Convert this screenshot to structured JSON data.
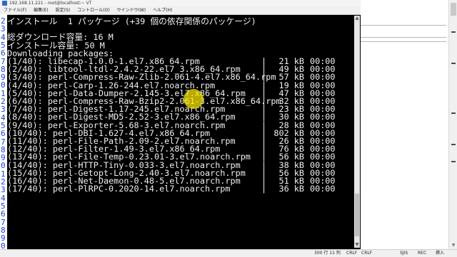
{
  "window": {
    "title": "192.168.11.221 - root@localhost:~ VT"
  },
  "menu": [
    "ファイル(F)",
    "編集(E)",
    "設定(S)",
    "コントロール(O)",
    "ウインドウ(W)",
    "ヘルプ(H)"
  ],
  "terminal": {
    "header_lines": [
      "インストール  1 パッケージ (+39 個の依存関係のパッケージ)",
      "",
      "総ダウンロード容量: 16 M",
      "インストール容量: 50 M",
      "Downloading packages:"
    ],
    "packages": [
      {
        "name": "(1/40): libecap-1.0.0-1.el7.x86_64.rpm",
        "size": "21 kB",
        "time": "00:00"
      },
      {
        "name": "(2/40): libtool-ltdl-2.4.2-22.el7_3.x86_64.rpm",
        "size": "49 kB",
        "time": "00:00"
      },
      {
        "name": "(3/40): perl-Compress-Raw-Zlib-2.061-4.el7.x86_64.rpm",
        "size": "57 kB",
        "time": "00:00"
      },
      {
        "name": "(4/40): perl-Carp-1.26-244.el7.noarch.rpm",
        "size": "19 kB",
        "time": "00:00"
      },
      {
        "name": "(5/40): perl-Data-Dumper-2.145-3.el7.x86_64.rpm",
        "size": "47 kB",
        "time": "00:00"
      },
      {
        "name": "(6/40): perl-Compress-Raw-Bzip2-2.061-3.el7.x86_64.rpm",
        "size": "32 kB",
        "time": "00:00"
      },
      {
        "name": "(7/40): perl-Digest-1.17-245.el7.noarch.rpm",
        "size": "23 kB",
        "time": "00:00"
      },
      {
        "name": "(8/40): perl-Digest-MD5-2.52-3.el7.x86_64.rpm",
        "size": "30 kB",
        "time": "00:00"
      },
      {
        "name": "(9/40): perl-Exporter-5.68-3.el7.noarch.rpm",
        "size": "28 kB",
        "time": "00:00"
      },
      {
        "name": "(10/40): perl-DBI-1.627-4.el7.x86_64.rpm",
        "size": "802 kB",
        "time": "00:00"
      },
      {
        "name": "(11/40): perl-File-Path-2.09-2.el7.noarch.rpm",
        "size": "26 kB",
        "time": "00:00"
      },
      {
        "name": "(12/40): perl-Filter-1.49-3.el7.x86_64.rpm",
        "size": "76 kB",
        "time": "00:00"
      },
      {
        "name": "(13/40): perl-File-Temp-0.23.01-3.el7.noarch.rpm",
        "size": "56 kB",
        "time": "00:00"
      },
      {
        "name": "(14/40): perl-HTTP-Tiny-0.033-3.el7.noarch.rpm",
        "size": "38 kB",
        "time": "00:00"
      },
      {
        "name": "(15/40): perl-Getopt-Long-2.40-3.el7.noarch.rpm",
        "size": "56 kB",
        "time": "00:00"
      },
      {
        "name": "(16/40): perl-Net-Daemon-0.48-5.el7.noarch.rpm",
        "size": "51 kB",
        "time": "00:00"
      },
      {
        "name": "(17/40): perl-PlRPC-0.2020-14.el7.noarch.rpm",
        "size": "36 kB",
        "time": "00:00"
      }
    ]
  },
  "gutter_digits": [
    "2",
    "3",
    "4",
    "5",
    "6",
    "7",
    "8",
    "9",
    "0",
    "1",
    "2",
    "3",
    "4",
    "5",
    "6",
    "7",
    "8",
    "9",
    "0",
    "1",
    "2",
    "3",
    "4",
    "5",
    "6",
    "7",
    "8",
    "9",
    "0"
  ],
  "statusbar": {
    "position": "300 行 11 列",
    "eol1": "CRLF",
    "eol2": "CRLF",
    "encoding": "SJIS",
    "mode": "REC",
    "ins": "挿入"
  },
  "colors": {
    "terminal_bg": "#000000",
    "terminal_fg": "#f0f0f0",
    "gutter_digit": "#1b3fd0",
    "cursor_highlight": "#ffeb00"
  }
}
